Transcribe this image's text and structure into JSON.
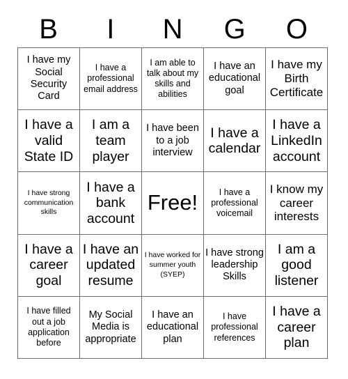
{
  "card": {
    "title_letters": [
      "B",
      "I",
      "N",
      "G",
      "O"
    ],
    "grid_size": "5x5",
    "colors": {
      "text": "#000000",
      "grid_line": "#6f6f6f",
      "background": "#ffffff"
    },
    "columns": {
      "B": [
        "I have my Social Security Card",
        "I have a valid State ID",
        "I have strong communication skills",
        "I have a career goal",
        "I have filled out a job application before"
      ],
      "I": [
        "I have a professional email address",
        "I am a team player",
        "I have a bank account",
        "I have an updated resume",
        "My Social Media is appropriate"
      ],
      "N": [
        "I am able to talk about my skills and abilities",
        "I have been to a job interview",
        "Free!",
        "I have worked for summer youth (SYEP)",
        "I have an educational plan"
      ],
      "G": [
        "I have an educational goal",
        "I have a calendar",
        "I have a professional voicemail",
        "I have strong leadership Skills",
        "I have professional references"
      ],
      "O": [
        "I have my Birth Certificate",
        "I have a LinkedIn account",
        "I know my career interests",
        "I am a good listener",
        "I have a career plan"
      ]
    },
    "cells": [
      {
        "id": "b1",
        "column": "B",
        "row": 1,
        "text": "I have my Social Security Card",
        "size": "md",
        "free": false
      },
      {
        "id": "i1",
        "column": "I",
        "row": 1,
        "text": "I have a professional email address",
        "size": "sm",
        "free": false
      },
      {
        "id": "n1",
        "column": "N",
        "row": 1,
        "text": "I am able to talk about my skills and abilities",
        "size": "sm",
        "free": false
      },
      {
        "id": "g1",
        "column": "G",
        "row": 1,
        "text": "I have an educational goal",
        "size": "md",
        "free": false
      },
      {
        "id": "o1",
        "column": "O",
        "row": 1,
        "text": "I have my Birth Certificate",
        "size": "lg",
        "free": false
      },
      {
        "id": "b2",
        "column": "B",
        "row": 2,
        "text": "I have a valid State ID",
        "size": "xl",
        "free": false
      },
      {
        "id": "i2",
        "column": "I",
        "row": 2,
        "text": "I am a team player",
        "size": "xl",
        "free": false
      },
      {
        "id": "n2",
        "column": "N",
        "row": 2,
        "text": "I have been to a job interview",
        "size": "md",
        "free": false
      },
      {
        "id": "g2",
        "column": "G",
        "row": 2,
        "text": "I have a calendar",
        "size": "xl",
        "free": false
      },
      {
        "id": "o2",
        "column": "O",
        "row": 2,
        "text": "I have a LinkedIn account",
        "size": "xl",
        "free": false
      },
      {
        "id": "b3",
        "column": "B",
        "row": 3,
        "text": "I have strong communication skills",
        "size": "xs",
        "free": false
      },
      {
        "id": "i3",
        "column": "I",
        "row": 3,
        "text": "I have a bank account",
        "size": "xl",
        "free": false
      },
      {
        "id": "n3",
        "column": "N",
        "row": 3,
        "text": "Free!",
        "size": "xxl",
        "free": true
      },
      {
        "id": "g3",
        "column": "G",
        "row": 3,
        "text": "I have a professional voicemail",
        "size": "sm",
        "free": false
      },
      {
        "id": "o3",
        "column": "O",
        "row": 3,
        "text": "I know my career interests",
        "size": "lg",
        "free": false
      },
      {
        "id": "b4",
        "column": "B",
        "row": 4,
        "text": "I have a career goal",
        "size": "xl",
        "free": false
      },
      {
        "id": "i4",
        "column": "I",
        "row": 4,
        "text": "I have an updated resume",
        "size": "xl",
        "free": false
      },
      {
        "id": "n4",
        "column": "N",
        "row": 4,
        "text": "I have worked for summer youth (SYEP)",
        "size": "xs",
        "free": false
      },
      {
        "id": "g4",
        "column": "G",
        "row": 4,
        "text": "I have strong leadership Skills",
        "size": "md",
        "free": false
      },
      {
        "id": "o4",
        "column": "O",
        "row": 4,
        "text": "I am a good listener",
        "size": "xl",
        "free": false
      },
      {
        "id": "b5",
        "column": "B",
        "row": 5,
        "text": "I have filled out a job application before",
        "size": "sm",
        "free": false
      },
      {
        "id": "i5",
        "column": "I",
        "row": 5,
        "text": "My Social Media is appropriate",
        "size": "md",
        "free": false
      },
      {
        "id": "n5",
        "column": "N",
        "row": 5,
        "text": "I have an educational plan",
        "size": "md",
        "free": false
      },
      {
        "id": "g5",
        "column": "G",
        "row": 5,
        "text": "I have professional references",
        "size": "sm",
        "free": false
      },
      {
        "id": "o5",
        "column": "O",
        "row": 5,
        "text": "I have a career plan",
        "size": "xl",
        "free": false
      }
    ]
  }
}
